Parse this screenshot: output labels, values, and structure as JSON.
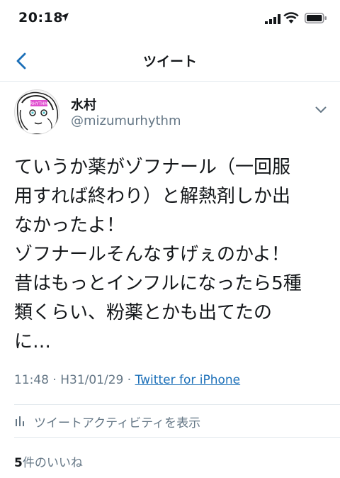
{
  "status_bar": {
    "time": "20:18"
  },
  "nav": {
    "title": "ツイート"
  },
  "tweet": {
    "display_name": "水村",
    "handle": "@mizumurhythm",
    "avatar_badge": "RHYTHM",
    "text_lines": [
      "ていうか薬がゾフナール（一回服",
      "用すれば終わり）と解熱剤しか出",
      "なかったよ！",
      "ゾフナールそんなすげぇのかよ！",
      "昔はもっとインフルになったら5種",
      "類くらい、粉薬とかも出てたの",
      "に…"
    ],
    "time": "11:48",
    "date": "H31/01/29",
    "separator": "·",
    "source": "Twitter for iPhone"
  },
  "activity": {
    "label": "ツイートアクティビティを表示"
  },
  "likes": {
    "count": "5",
    "label": "件のいいね"
  },
  "colors": {
    "link": "#1b6fb8",
    "muted": "#657786",
    "text": "#14171a",
    "divider": "#e1e8ed"
  }
}
